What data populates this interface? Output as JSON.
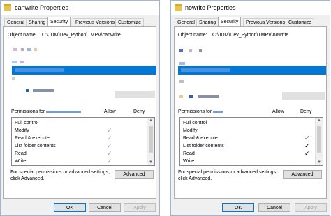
{
  "tabs": [
    "General",
    "Sharing",
    "Security",
    "Previous Versions",
    "Customize"
  ],
  "object_name_label": "Object name:",
  "permissions_allow": "Allow",
  "permissions_deny": "Deny",
  "special_text": "For special permissions or advanced settings, click Advanced.",
  "advanced_label": "Advanced",
  "ok_label": "OK",
  "cancel_label": "Cancel",
  "apply_label": "Apply",
  "permissions": [
    "Full control",
    "Modify",
    "Read & execute",
    "List folder contents",
    "Read",
    "Write"
  ],
  "left": {
    "title": "canwrite Properties",
    "object_path": "C:\\JDM\\Dev_Python\\TMPV\\canwrite",
    "permissions_for": "Permissions for",
    "checks": [
      {
        "allow": false,
        "deny": false
      },
      {
        "allow": true,
        "deny": false
      },
      {
        "allow": true,
        "deny": false
      },
      {
        "allow": true,
        "deny": false
      },
      {
        "allow": true,
        "deny": false
      },
      {
        "allow": true,
        "deny": false
      }
    ],
    "check_style": "gray"
  },
  "right": {
    "title": "nowrite Properties",
    "object_path": "C:\\JDM\\Dev_Python\\TMPV\\nowrite",
    "permissions_for": "Permissions for",
    "checks": [
      {
        "allow": false,
        "deny": false
      },
      {
        "allow": false,
        "deny": false
      },
      {
        "allow": false,
        "deny": true
      },
      {
        "allow": false,
        "deny": true
      },
      {
        "allow": false,
        "deny": true
      },
      {
        "allow": false,
        "deny": false
      }
    ],
    "check_style": "black"
  },
  "colors": {
    "accent": "#0078d7",
    "window_bg": "#f0f0f0",
    "panel_bg": "#ffffff"
  },
  "icons": {
    "check": "check-icon",
    "folder": "folder-icon"
  }
}
